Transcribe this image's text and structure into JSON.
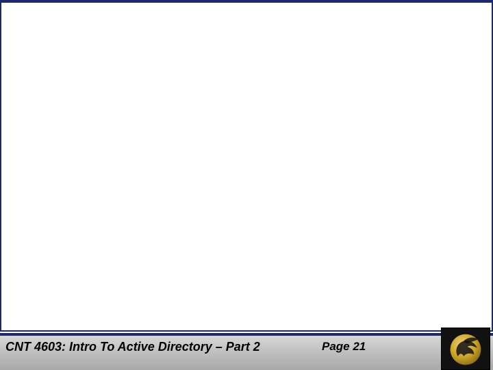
{
  "footer": {
    "title": "CNT 4603: Intro To Active Directory – Part 2",
    "page_label": "Page 21"
  },
  "logo": {
    "name": "ucf-pegasus-logo",
    "gold": "#c9a227",
    "gold_light": "#e6c35a",
    "bg": "#111111"
  },
  "colors": {
    "rule": "#1a2a6c",
    "footer_grad_top": "#d8d8d8",
    "footer_grad_bottom": "#a8a8a8"
  }
}
